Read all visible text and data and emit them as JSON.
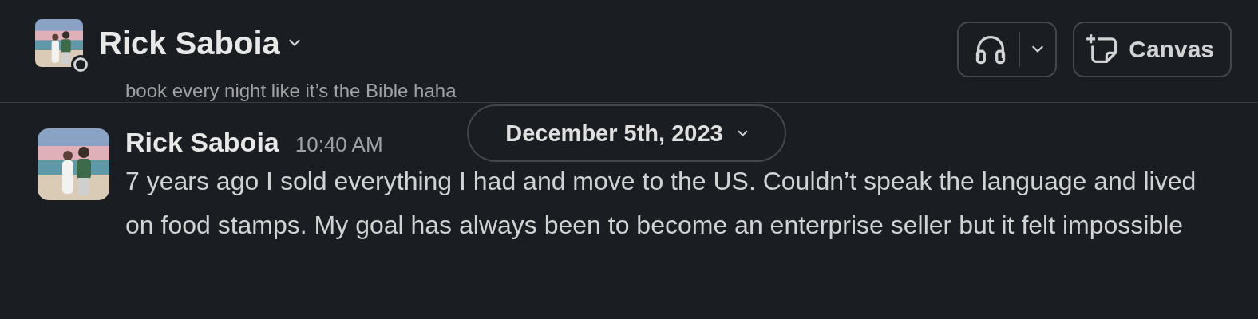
{
  "header": {
    "title": "Rick Saboia",
    "buttons": [
      {
        "kind": "huddle"
      },
      {
        "kind": "canvas",
        "label": "Canvas"
      }
    ]
  },
  "previous_message_tail": "book every night like it’s the Bible haha",
  "date_divider": "December 5th, 2023",
  "messages": [
    {
      "author": "Rick Saboia",
      "time": "10:40 AM",
      "text": "7 years ago I sold everything I had and move to the US. Couldn’t speak the language and lived on food stamps. My goal has always been to become an enterprise seller but it felt impossible"
    }
  ]
}
